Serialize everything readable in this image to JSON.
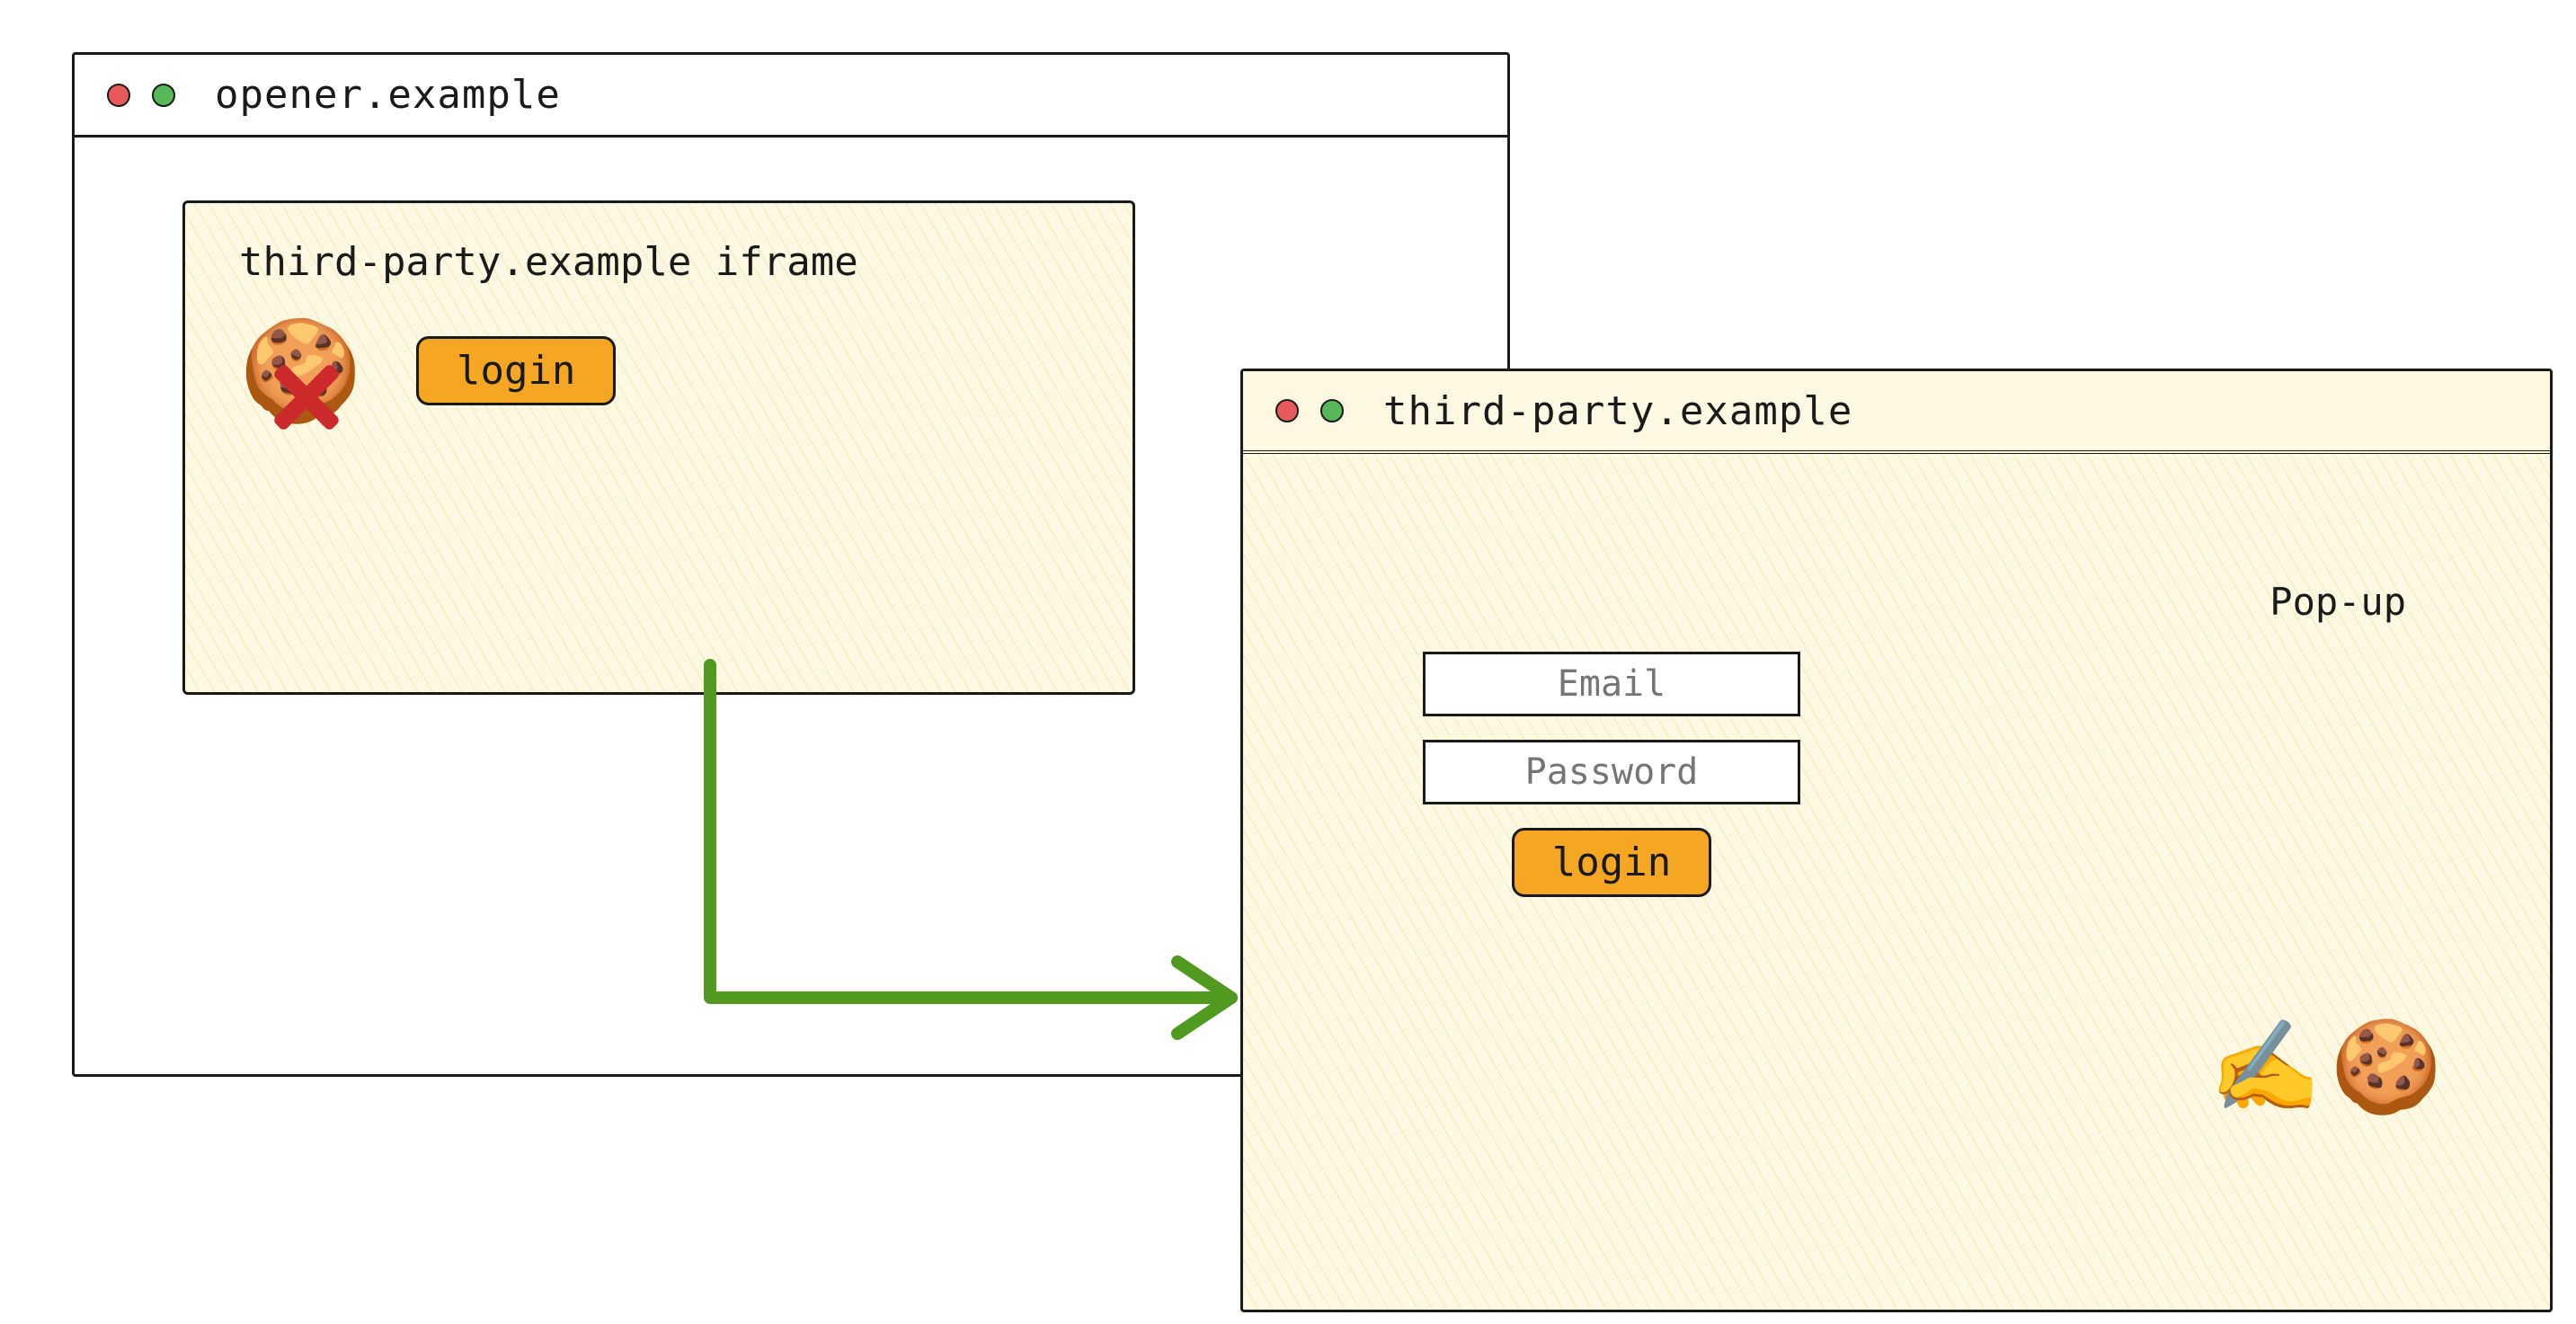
{
  "opener_window": {
    "title": "opener.example",
    "iframe": {
      "title": "third-party.example iframe",
      "login_button": "login",
      "cookie_icon": "cookie-icon",
      "blocked_overlay": "cross-icon"
    }
  },
  "popup_window": {
    "title": "third-party.example",
    "label": "Pop-up",
    "email_placeholder": "Email",
    "password_placeholder": "Password",
    "login_button": "login",
    "writing_icon": "writing-hand-icon",
    "cookie_icon": "cookie-icon"
  },
  "colors": {
    "accent_orange": "#f5a623",
    "arrow_green": "#4f9a1f",
    "cross_red": "#cc2a2a",
    "hatch_yellow": "#fdf8e1"
  }
}
